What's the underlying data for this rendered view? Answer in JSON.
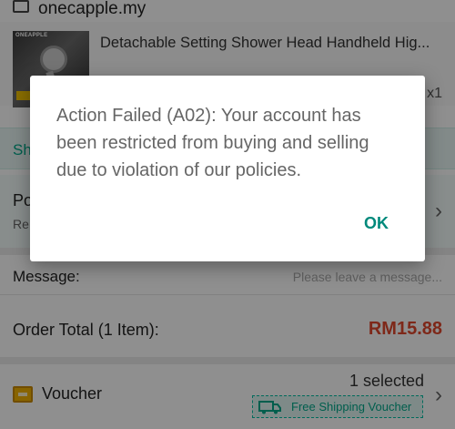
{
  "shop": {
    "name": "onecapple.my"
  },
  "product": {
    "brand_logo_text": "ONEAPPLE",
    "title": "Detachable Setting Shower Head Handheld Hig...",
    "quantity": "x1"
  },
  "shipping": {
    "label": "Sh"
  },
  "policy": {
    "title": "Po",
    "subtitle": "Re"
  },
  "message": {
    "label": "Message:",
    "placeholder": "Please leave a message..."
  },
  "order_total": {
    "label": "Order Total (1 Item):",
    "amount": "RM15.88"
  },
  "voucher": {
    "label": "Voucher",
    "selected_text": "1 selected",
    "chip_text": "Free Shipping Voucher"
  },
  "dialog": {
    "message": "Action Failed (A02): Your account has been restricted from buying and selling due to violation of our policies.",
    "ok_label": "OK"
  },
  "colors": {
    "accent_teal": "#00897b",
    "price_red": "#e0482d",
    "overlay": "rgba(0,0,0,0.44)"
  }
}
